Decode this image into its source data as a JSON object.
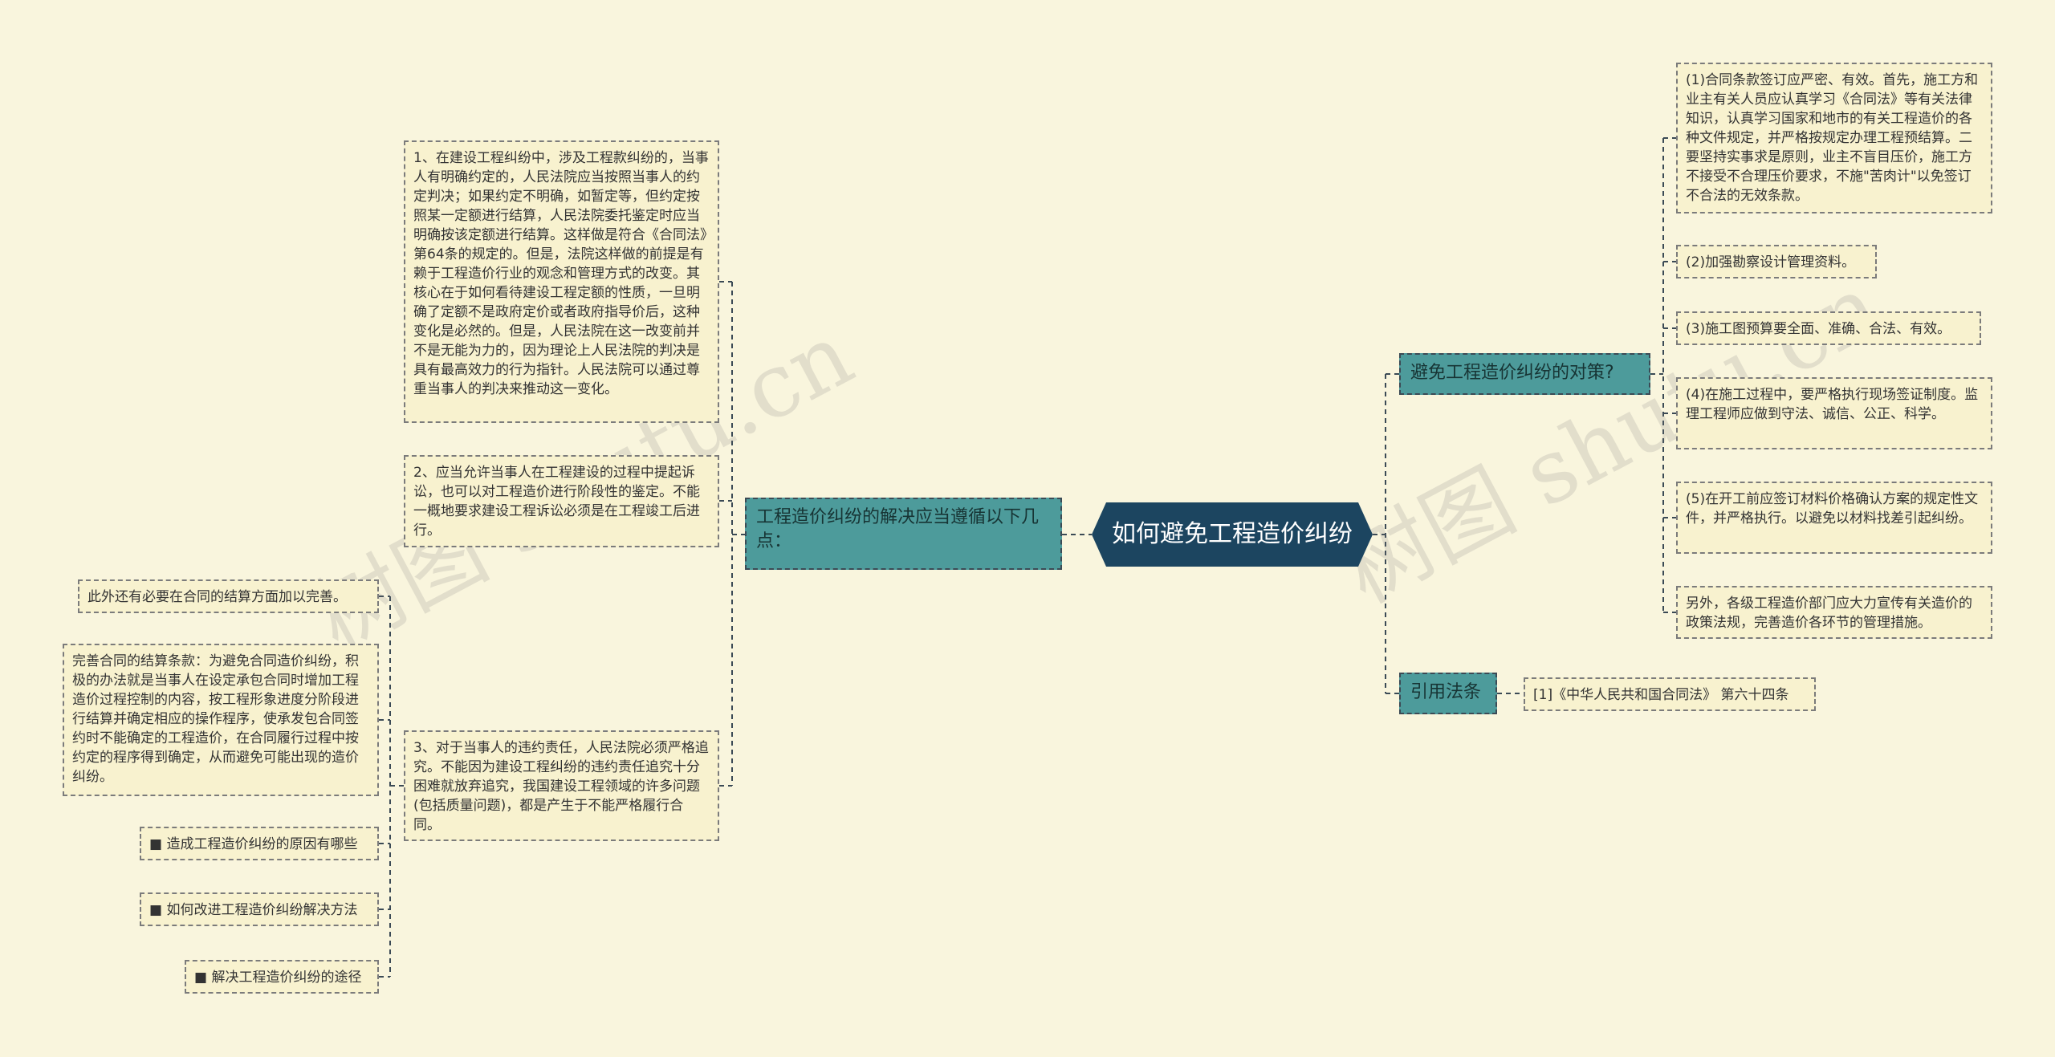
{
  "watermark": {
    "text": "树图 shutu.cn"
  },
  "root": {
    "label": "如何避免工程造价纠纷"
  },
  "left_branch": {
    "label": "工程造价纠纷的解决应当遵循以下几点：",
    "children": [
      "1、在建设工程纠纷中，涉及工程款纠纷的，当事人有明确约定的，人民法院应当按照当事人的约定判决；如果约定不明确，如暂定等，但约定按照某一定额进行结算，人民法院委托鉴定时应当明确按该定额进行结算。这样做是符合《合同法》第64条的规定的。但是，法院这样做的前提是有赖于工程造价行业的观念和管理方式的改变。其核心在于如何看待建设工程定额的性质，一旦明确了定额不是政府定价或者政府指导价后，这种变化是必然的。但是，人民法院在这一改变前并不是无能为力的，因为理论上人民法院的判决是具有最高效力的行为指针。人民法院可以通过尊重当事人的判决来推动这一变化。",
      "2、应当允许当事人在工程建设的过程中提起诉讼，也可以对工程造价进行阶段性的鉴定。不能一概地要求建设工程诉讼必须是在工程竣工后进行。",
      "3、对于当事人的违约责任，人民法院必须严格追究。不能因为建设工程纠纷的违约责任追究十分困难就放弃追究，我国建设工程领域的许多问题(包括质量问题)，都是产生于不能严格履行合同。"
    ],
    "sub_children": [
      "此外还有必要在合同的结算方面加以完善。",
      "完善合同的结算条款：为避免合同造价纠纷，积极的办法就是当事人在设定承包合同时增加工程造价过程控制的内容，按工程形象进度分阶段进行结算并确定相应的操作程序，使承发包合同签约时不能确定的工程造价，在合同履行过程中按约定的程序得到确定，从而避免可能出现的造价纠纷。",
      "■ 造成工程造价纠纷的原因有哪些",
      "■ 如何改进工程造价纠纷解决方法",
      "■ 解决工程造价纠纷的途径"
    ]
  },
  "right_branch_1": {
    "label": "避免工程造价纠纷的对策?",
    "children": [
      "(1)合同条款签订应严密、有效。首先，施工方和业主有关人员应认真学习《合同法》等有关法律知识，认真学习国家和地市的有关工程造价的各种文件规定，并严格按规定办理工程预结算。二要坚持实事求是原则，业主不盲目压价，施工方不接受不合理压价要求，不施\"苦肉计\"以免签订不合法的无效条款。",
      "(2)加强勘察设计管理资料。",
      "(3)施工图预算要全面、准确、合法、有效。",
      "(4)在施工过程中，要严格执行现场签证制度。监理工程师应做到守法、诚信、公正、科学。",
      "(5)在开工前应签订材料价格确认方案的规定性文件，并严格执行。以避免以材料找差引起纠纷。",
      "另外，各级工程造价部门应大力宣传有关造价的政策法规，完善造价各环节的管理措施。"
    ]
  },
  "right_branch_2": {
    "label": "引用法条",
    "children": [
      "[1]《中华人民共和国合同法》 第六十四条"
    ]
  },
  "colors": {
    "background": "#f9f5dd",
    "root_fill": "#1c4560",
    "branch_fill": "#4d9b9b",
    "leaf_fill": "#f8f2cf",
    "line": "#3b4a55"
  }
}
